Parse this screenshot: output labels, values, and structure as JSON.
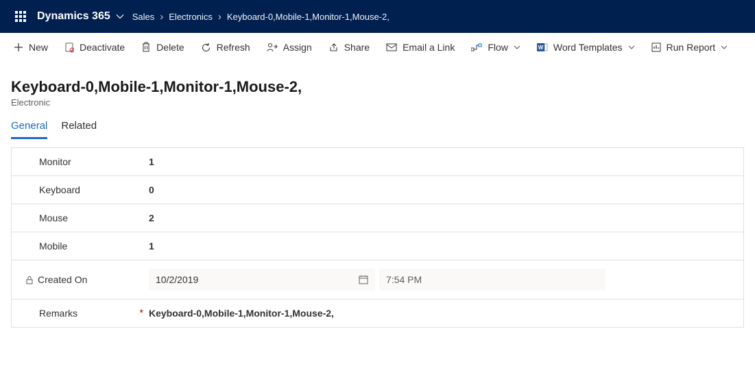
{
  "header": {
    "brand": "Dynamics 365",
    "breadcrumb": [
      "Sales",
      "Electronics",
      "Keyboard-0,Mobile-1,Monitor-1,Mouse-2,"
    ]
  },
  "commands": {
    "new": "New",
    "deactivate": "Deactivate",
    "delete": "Delete",
    "refresh": "Refresh",
    "assign": "Assign",
    "share": "Share",
    "email_a_link": "Email a Link",
    "flow": "Flow",
    "word_templates": "Word Templates",
    "run_report": "Run Report"
  },
  "page": {
    "title": "Keyboard-0,Mobile-1,Monitor-1,Mouse-2,",
    "subtitle": "Electronic"
  },
  "tabs": {
    "general": "General",
    "related": "Related"
  },
  "form": {
    "labels": {
      "monitor": "Monitor",
      "keyboard": "Keyboard",
      "mouse": "Mouse",
      "mobile": "Mobile",
      "created_on": "Created On",
      "remarks": "Remarks"
    },
    "values": {
      "monitor": "1",
      "keyboard": "0",
      "mouse": "2",
      "mobile": "1",
      "created_date": "10/2/2019",
      "created_time": "7:54 PM",
      "remarks": "Keyboard-0,Mobile-1,Monitor-1,Mouse-2,"
    }
  }
}
